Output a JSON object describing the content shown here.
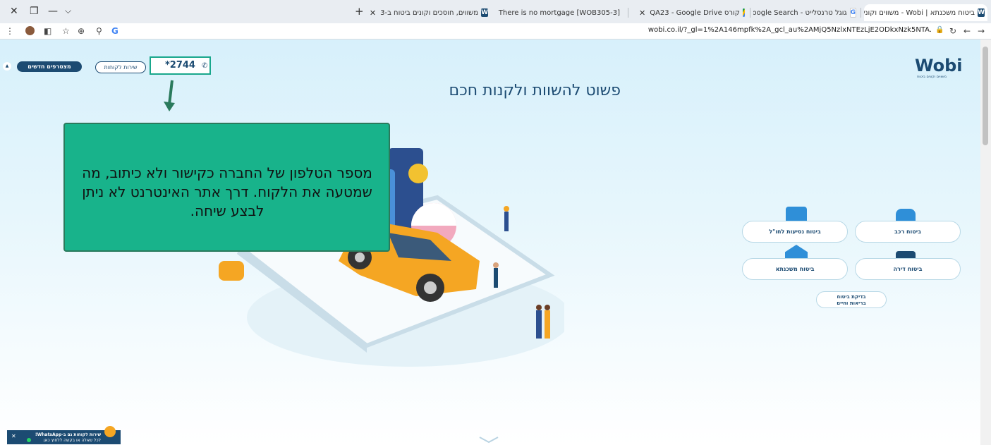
{
  "tabs": [
    {
      "title": "ביטוח משכנתא | Wobi - משווים וקונים ביטוח",
      "favicon": "wobi-favicon"
    },
    {
      "title": "גוגל טרנסלייט - Google Search",
      "favicon": "google-favicon"
    },
    {
      "title": "קורס QA23 - Google Drive",
      "favicon": "drive-favicon"
    },
    {
      "title": "[WOB305-3] There is no mortgage",
      "favicon": "jira-favicon"
    },
    {
      "title": "משווים, חוסכים וקונים ביטוח ב-3",
      "favicon": "wobi-favicon"
    }
  ],
  "address": {
    "url": "wobi.co.il/?_gl=1%2A146mpfk%2A_gcl_au%2AMjQ5NzlxNTEzLjE2ODkxNzk5NTA."
  },
  "header": {
    "new_customers": "מצטרפים חדשים",
    "customer_service": "שירות לקוחות",
    "phone": "*2744",
    "logo": "Wobi",
    "logo_sub": "משווים וקונים ביטוח"
  },
  "headline": "פשוט להשוות ולקנות חכם",
  "callout": {
    "text": "מספר הטלפון של החברה כקישור ולא כיתוב, מה שמטעה את הלקוח. דרך אתר האינטרנט לא ניתן לבצע שיחה."
  },
  "insurance": {
    "car": "ביטוח רכב",
    "travel": "ביטוח נסיעות לחו\"ל",
    "home": "ביטוח דירה",
    "mortgage": "ביטוח משכנתא",
    "life_check_1": "בדיקת ביטוח",
    "life_check_2": "בריאות וחיים"
  },
  "whatsapp": {
    "line1": "שירות לקוחות גם ב-WhatsApp!",
    "line2": "לכל שאלה או בקשה ללחוץ כאן"
  },
  "colors": {
    "brand": "#1c4b72",
    "callout": "#18b38b",
    "sky": "#d7f0fb"
  }
}
